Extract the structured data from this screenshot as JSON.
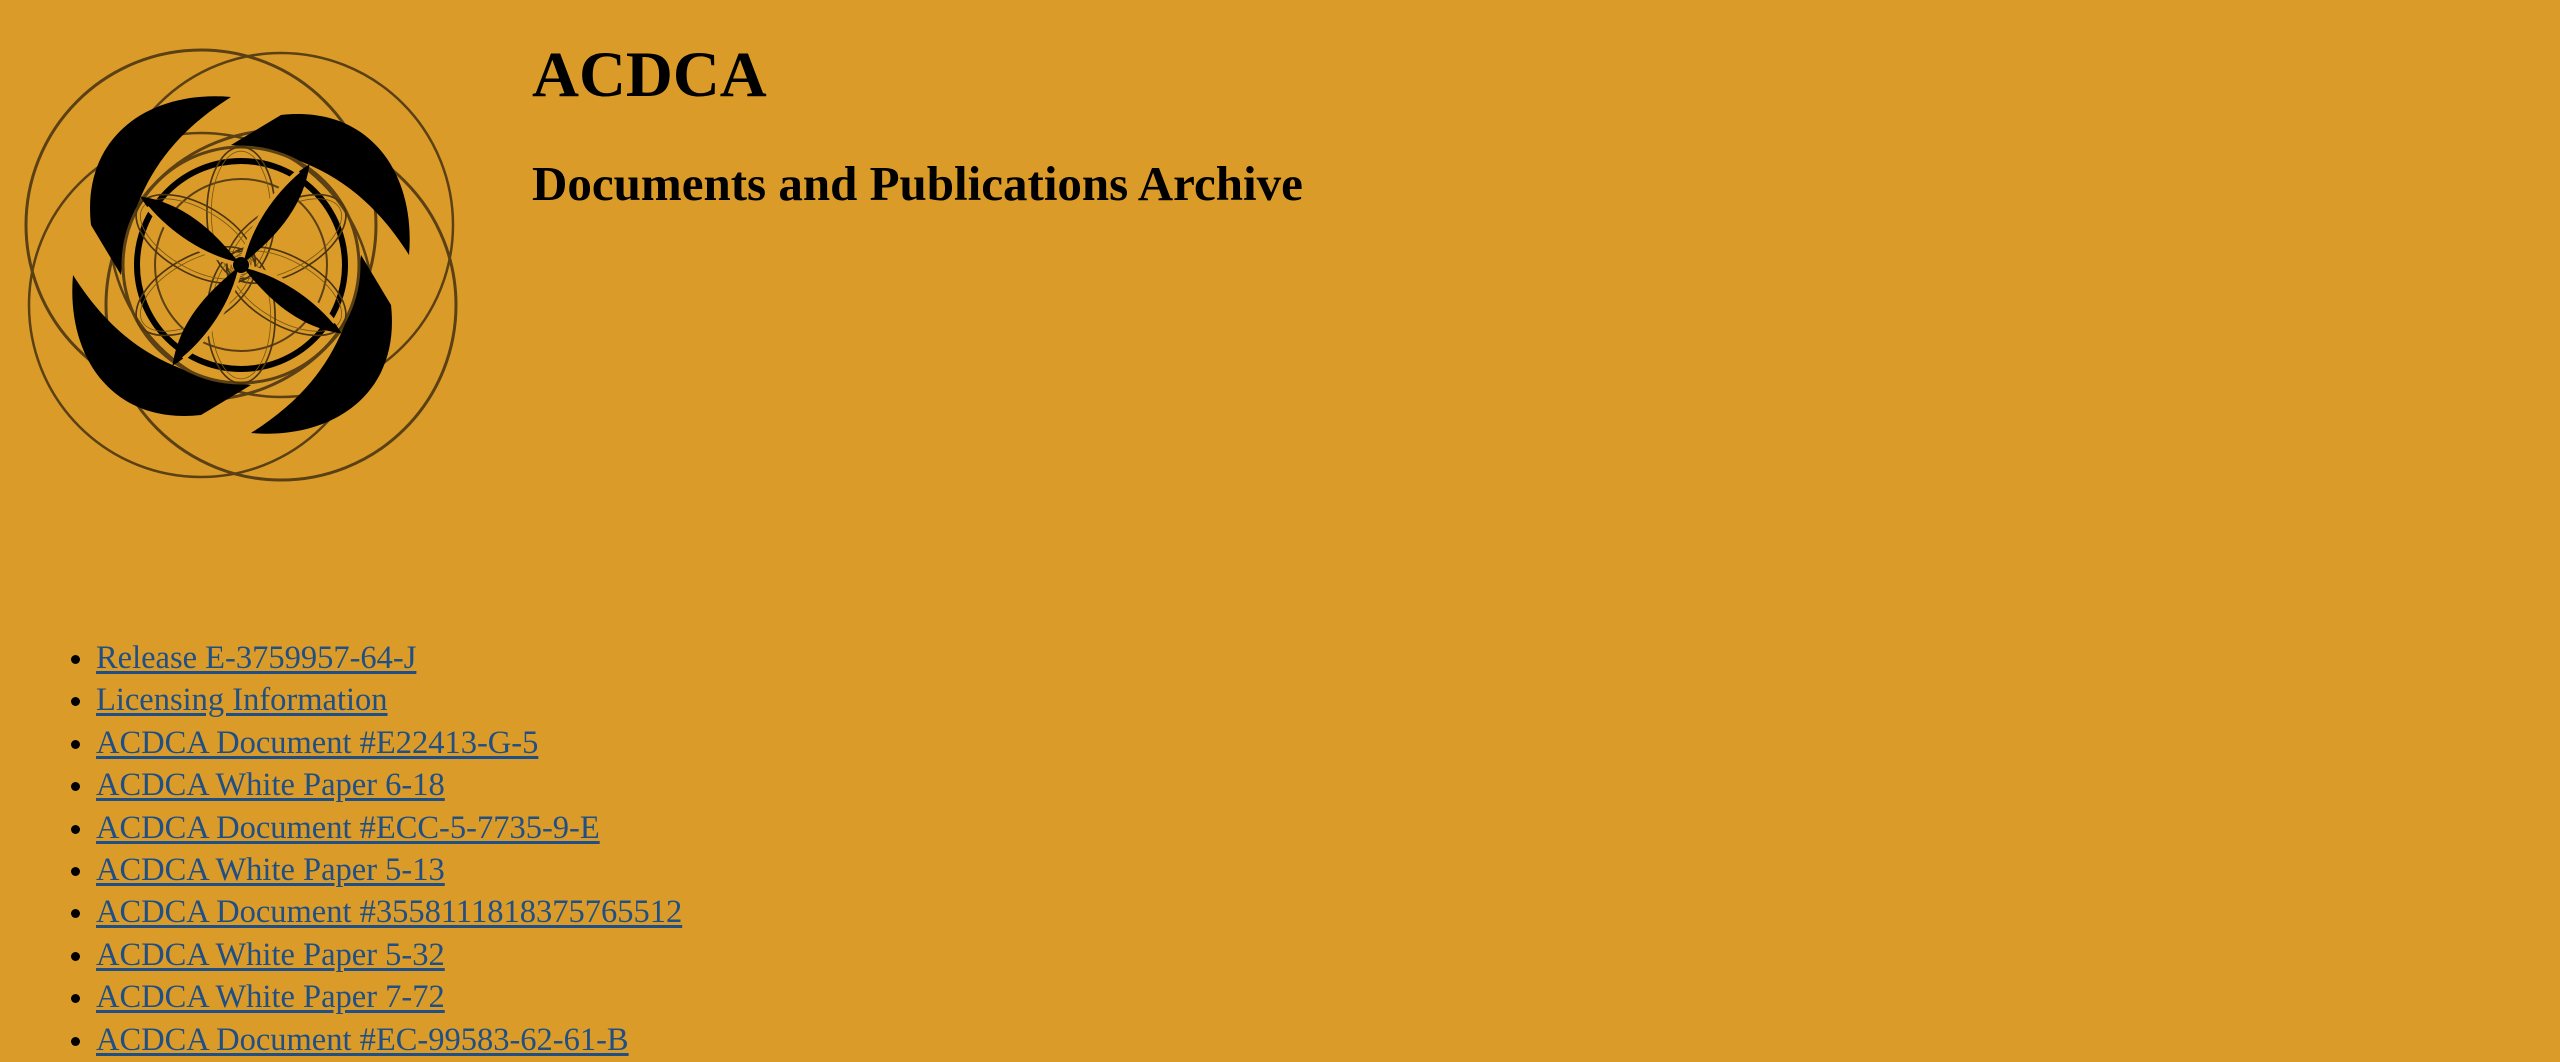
{
  "header": {
    "title": "ACDCA",
    "subtitle": "Documents and Publications Archive"
  },
  "logo": {
    "icon": "acdca-knot-logo-icon"
  },
  "colors": {
    "background": "#db9b29",
    "link": "#1f4f84",
    "text": "#000000"
  },
  "links": [
    {
      "label": "Release E-3759957-64-J"
    },
    {
      "label": "Licensing Information"
    },
    {
      "label": "ACDCA Document #E22413-G-5"
    },
    {
      "label": "ACDCA White Paper 6-18"
    },
    {
      "label": "ACDCA Document #ECC-5-7735-9-E"
    },
    {
      "label": "ACDCA White Paper 5-13"
    },
    {
      "label": "ACDCA Document #3558111818375765512"
    },
    {
      "label": "ACDCA White Paper 5-32"
    },
    {
      "label": "ACDCA White Paper 7-72"
    },
    {
      "label": "ACDCA Document #EC-99583-62-61-B"
    }
  ]
}
